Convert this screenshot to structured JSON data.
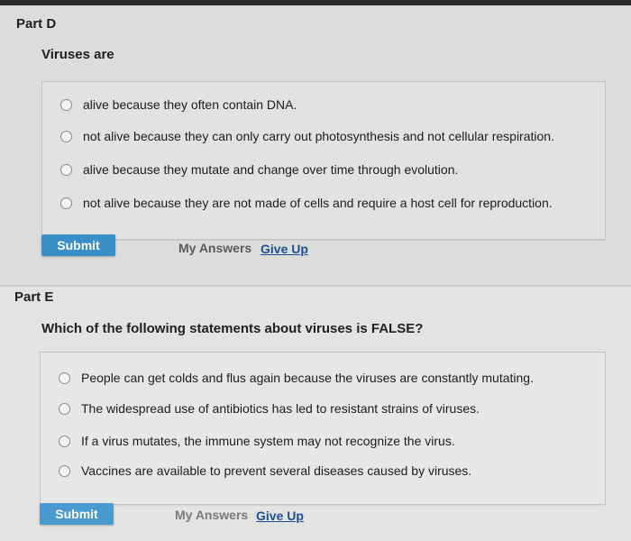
{
  "part_d": {
    "label": "Part D",
    "question": "Viruses are",
    "options": [
      "alive because they often contain DNA.",
      "not alive because they can only carry out photosynthesis and not cellular respiration.",
      "alive because they mutate and change over time through evolution.",
      "not alive because they are not made of cells and require a host cell for reproduction."
    ],
    "submit_label": "Submit",
    "my_answers_label": "My Answers",
    "give_up_label": "Give Up"
  },
  "part_e": {
    "label": "Part E",
    "question": "Which of the following statements about viruses is FALSE?",
    "options": [
      "People can get colds and flus again because the viruses are constantly mutating.",
      "The widespread use of antibiotics has led to resistant strains of viruses.",
      "If a virus mutates, the immune system may not recognize the virus.",
      "Vaccines are available to prevent several diseases caused by viruses."
    ],
    "submit_label": "Submit",
    "my_answers_label": "My Answers",
    "give_up_label": "Give Up"
  }
}
